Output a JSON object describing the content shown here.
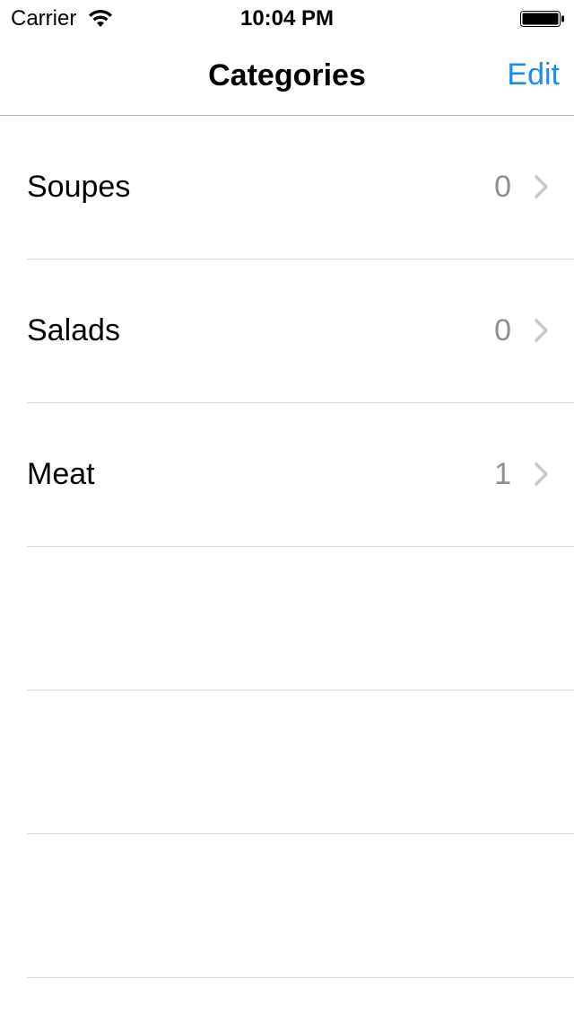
{
  "status_bar": {
    "carrier": "Carrier",
    "time": "10:04 PM",
    "icons": [
      "wifi-icon",
      "battery-icon"
    ]
  },
  "nav_bar": {
    "title": "Categories",
    "edit_label": "Edit",
    "accent_color": "#1a8cf0"
  },
  "categories": [
    {
      "name": "Soupes",
      "count": "0"
    },
    {
      "name": "Salads",
      "count": "0"
    },
    {
      "name": "Meat",
      "count": "1"
    }
  ],
  "empty_rows": 3
}
